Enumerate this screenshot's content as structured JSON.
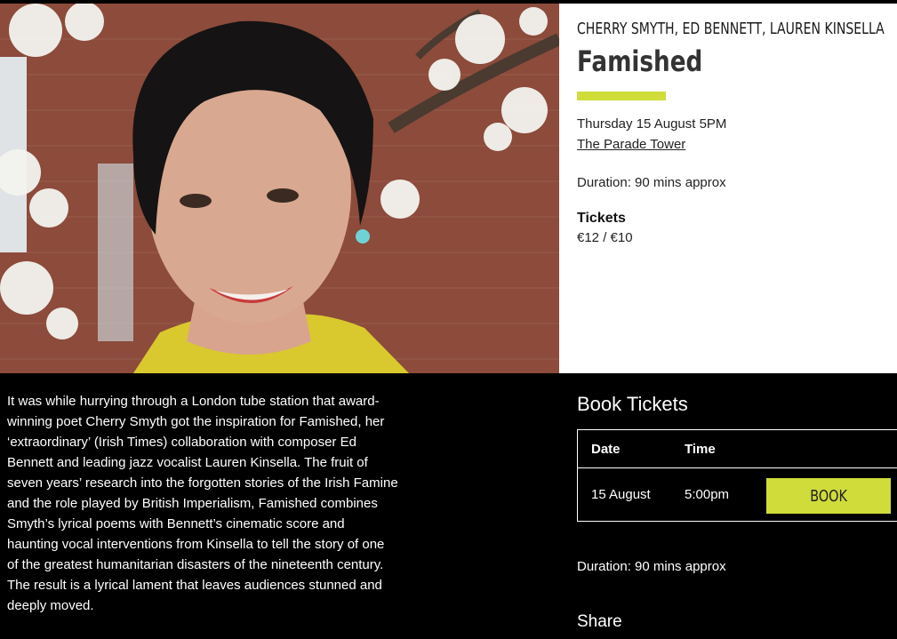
{
  "event": {
    "artists": "CHERRY SMYTH, ED BENNETT, LAUREN KINSELLA",
    "title": "Famished",
    "datetime": "Thursday 15 August 5PM",
    "venue": "The Parade Tower",
    "duration": "Duration: 90 mins approx",
    "tickets_heading": "Tickets",
    "price": "€12 / €10"
  },
  "description": "It was while hurrying through a London tube station that award-winning poet Cherry Smyth got the inspiration for Famished, her ‘extraordinary’ (Irish Times) collaboration with composer Ed Bennett and leading jazz vocalist Lauren Kinsella. The fruit of seven years’ research into the forgotten stories of the Irish Famine and the role played by British Imperialism, Famished combines Smyth’s lyrical poems with Bennett’s cinematic score and haunting vocal interventions from Kinsella to tell the story of one of the greatest humanitarian disasters of the nineteenth century. The result is a lyrical lament that leaves audiences stunned and deeply moved.",
  "booking": {
    "heading": "Book Tickets",
    "columns": [
      "Date",
      "Time"
    ],
    "rows": [
      {
        "date": "15 August",
        "time": "5:00pm",
        "button": "BOOK"
      }
    ],
    "duration": "Duration: 90 mins approx",
    "share": "Share"
  },
  "colors": {
    "accent": "#cfdc3a"
  }
}
